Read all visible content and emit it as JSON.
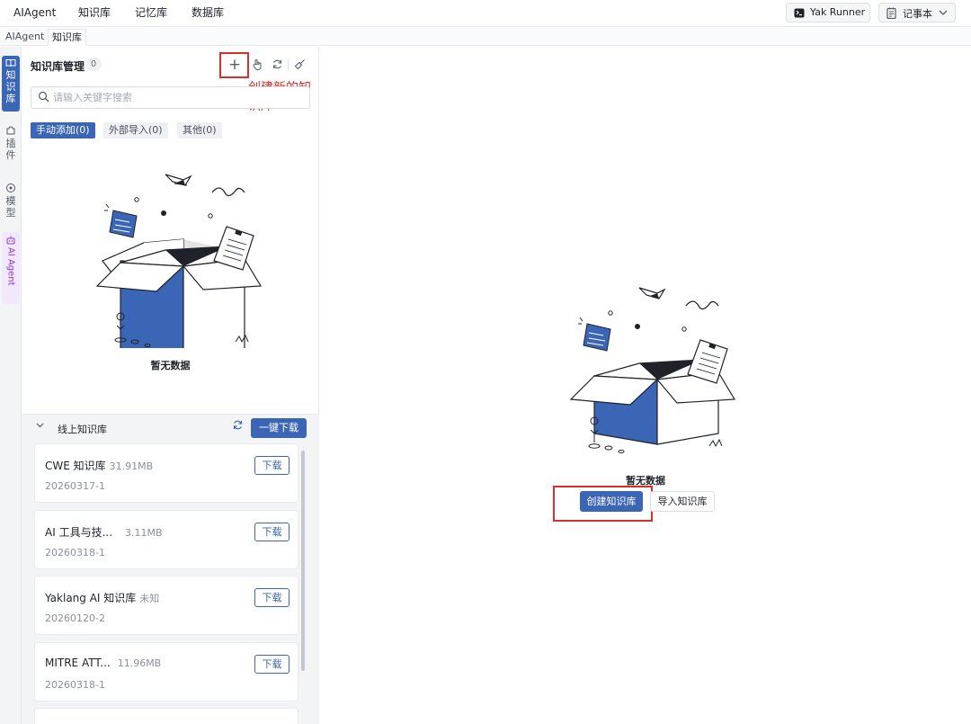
{
  "menubar": {
    "items": [
      "AIAgent",
      "知识库",
      "记忆库",
      "数据库"
    ],
    "yak_runner": "Yak Runner",
    "notepad": "记事本"
  },
  "tabs": [
    "AIAgent",
    "知识库"
  ],
  "sidebar": {
    "items": [
      {
        "label": "知识库",
        "icon": "book-icon",
        "active": true
      },
      {
        "label": "插件",
        "icon": "puzzle-icon"
      },
      {
        "label": "模型",
        "icon": "model-icon"
      },
      {
        "label": "AI Agent",
        "icon": "robot-icon"
      }
    ]
  },
  "kb_panel": {
    "title": "知识库管理",
    "count": "0",
    "annotation": "创建新的知识库",
    "search_placeholder": "请输入关键字搜索",
    "filters": [
      "手动添加(0)",
      "外部导入(0)",
      "其他(0)"
    ],
    "empty_text": "暂无数据"
  },
  "online": {
    "title": "线上知识库",
    "download_all": "一键下载",
    "download_label": "下载",
    "items": [
      {
        "name": "CWE 知识库",
        "size": "31.91MB",
        "date": "20260317-1"
      },
      {
        "name": "AI 工具与技...",
        "size": "3.11MB",
        "date": "20260318-1"
      },
      {
        "name": "Yaklang AI 知识库",
        "size": "未知",
        "date": "20260120-2"
      },
      {
        "name": "MITRE ATT...",
        "size": "11.96MB",
        "date": "20260318-1"
      }
    ]
  },
  "main": {
    "empty_text": "暂无数据",
    "create_button": "创建知识库",
    "import_button": "导入知识库"
  },
  "colors": {
    "accent": "#3b66b5",
    "highlight": "#d9312a",
    "ai_agent": "#8a3bd8"
  }
}
